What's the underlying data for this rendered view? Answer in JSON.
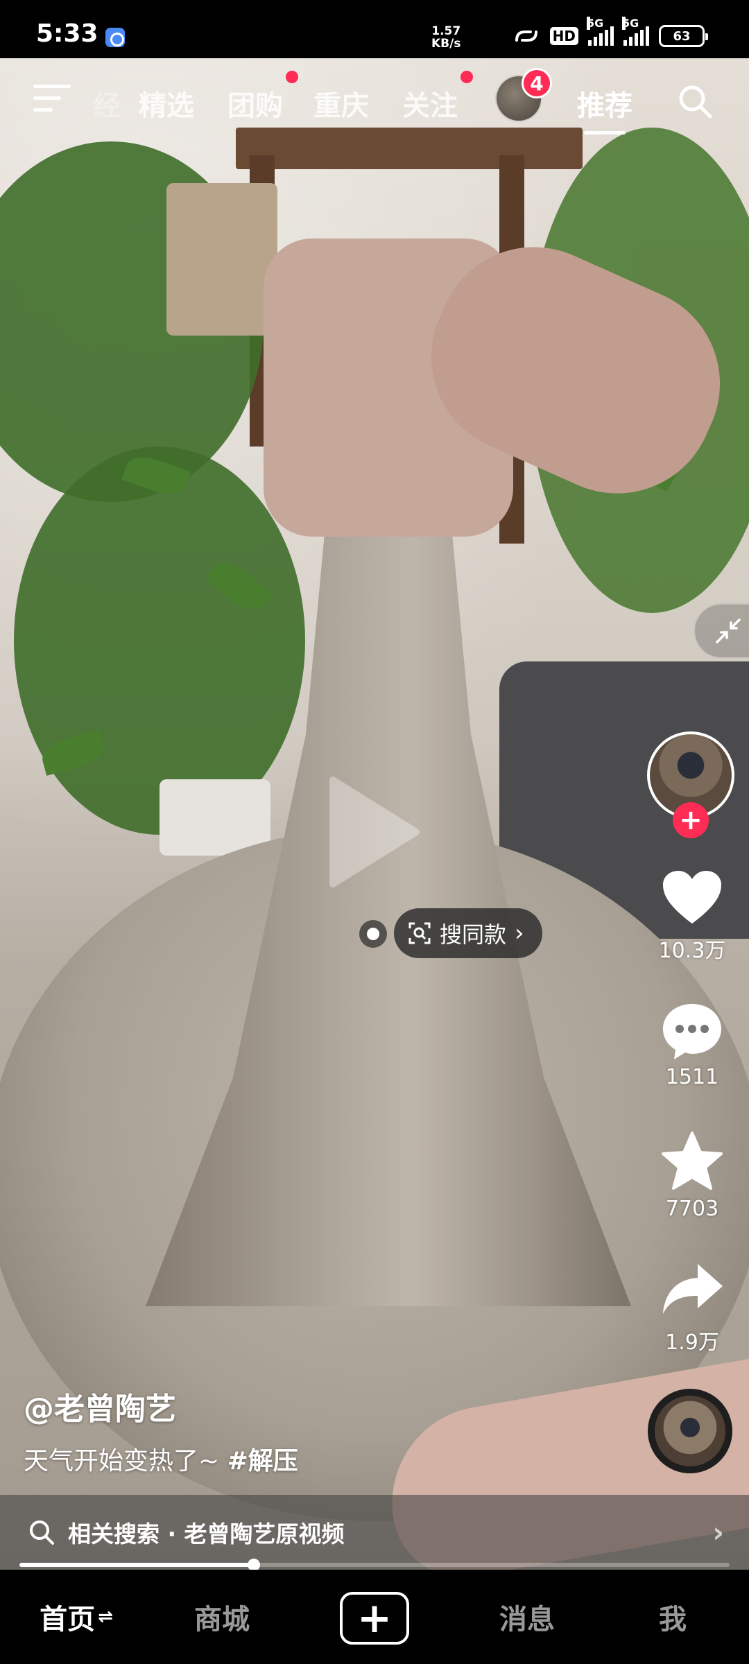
{
  "status_bar": {
    "time": "5:33",
    "net_speed_value": "1.57",
    "net_speed_unit": "KB/s",
    "hd_label": "HD",
    "signal1_label": "5G",
    "signal2_label": "5G",
    "battery": "63"
  },
  "top_nav": {
    "faded_tab": "经",
    "tabs": [
      "精选",
      "团购",
      "重庆",
      "关注"
    ],
    "active_tab": "推荐",
    "avatar_badge": "4"
  },
  "rail": {
    "likes": "10.3万",
    "comments": "1511",
    "favorites": "7703",
    "shares": "1.9万"
  },
  "overlay": {
    "search_same_label": "搜同款"
  },
  "caption": {
    "author": "@老曾陶艺",
    "text": "天气开始变热了~",
    "hashtag": "#解压"
  },
  "related": {
    "label": "相关搜索 · 老曾陶艺原视频"
  },
  "playback": {
    "progress": 0.33
  },
  "bottom_nav": {
    "home": "首页",
    "mall": "商城",
    "add": "+",
    "messages": "消息",
    "me": "我"
  }
}
